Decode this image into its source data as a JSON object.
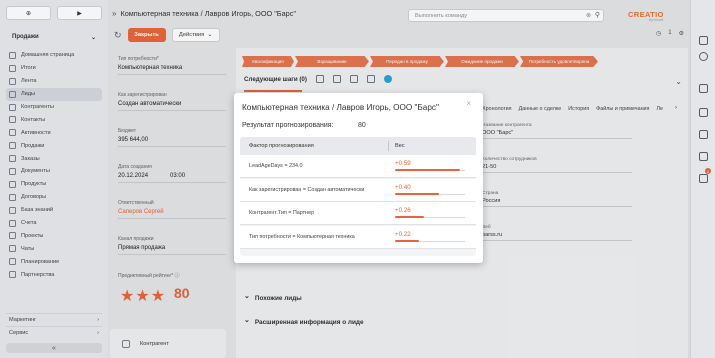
{
  "topbar": {
    "breadcrumb": "Компьютерная техника / Лавров Игорь, ООО \"Барс\"",
    "command_placeholder": "Выполнить команду",
    "brand": "CREATIO"
  },
  "toolbar": {
    "close_label": "Закрыть",
    "actions_label": "Действия",
    "counter": "1"
  },
  "sidebar": {
    "workplace": "Продажи",
    "items": [
      {
        "label": "Домашняя страница",
        "icon": "home-icon"
      },
      {
        "label": "Итоги",
        "icon": "chart-icon"
      },
      {
        "label": "Лента",
        "icon": "feed-icon"
      },
      {
        "label": "Лиды",
        "icon": "lead-icon",
        "active": true
      },
      {
        "label": "Контрагенты",
        "icon": "company-icon"
      },
      {
        "label": "Контакты",
        "icon": "contact-icon"
      },
      {
        "label": "Активности",
        "icon": "activity-icon"
      },
      {
        "label": "Продажи",
        "icon": "sales-icon"
      },
      {
        "label": "Заказы",
        "icon": "order-icon"
      },
      {
        "label": "Документы",
        "icon": "document-icon"
      },
      {
        "label": "Продукты",
        "icon": "product-icon"
      },
      {
        "label": "Договоры",
        "icon": "contract-icon"
      },
      {
        "label": "База знаний",
        "icon": "knowledge-icon"
      },
      {
        "label": "Счета",
        "icon": "invoice-icon"
      },
      {
        "label": "Проекты",
        "icon": "project-icon"
      },
      {
        "label": "Чаты",
        "icon": "chat-icon"
      },
      {
        "label": "Планирование",
        "icon": "planning-icon"
      },
      {
        "label": "Партнерства",
        "icon": "partner-icon"
      }
    ],
    "groups": [
      "Маркетинг",
      "Сервис"
    ]
  },
  "leftfields": [
    {
      "label": "Тип потребности*",
      "value": "Компьютерная техника"
    },
    {
      "label": "Как зарегистрирован",
      "value": "Создан автоматически"
    },
    {
      "label": "Бюджет",
      "value": "395 644,00"
    },
    {
      "label": "Дата создания",
      "value": "20.12.2024",
      "value2": "03:00"
    },
    {
      "label": "Ответственный",
      "value": "Саперов Сергей",
      "link": true
    },
    {
      "label": "Канал продажи",
      "value": "Прямая продажа"
    }
  ],
  "rating": {
    "label": "Предиктивный рейтинг*",
    "stars": 3,
    "value": "80"
  },
  "kontragent_box": "Контрагент",
  "stages": [
    {
      "label": "Квалификация",
      "w": 52
    },
    {
      "label": "Взращивание",
      "w": 74
    },
    {
      "label": "Передан в продажу",
      "w": 74
    },
    {
      "label": "Ожидание продажи",
      "w": 74
    },
    {
      "label": "Потребность удовлетворена",
      "w": 78
    }
  ],
  "next_steps": "Следующие шаги (0)",
  "right_tabs": [
    "Хронология",
    "Данные о сделке",
    "История",
    "Файлы и примечания",
    "Ле"
  ],
  "right_fields": [
    {
      "label": "Название контрагента",
      "value": "ООО \"Барс\""
    },
    {
      "label": "Количество сотрудников",
      "value": "21-50"
    },
    {
      "label": "Страна",
      "value": "Россия"
    },
    {
      "label": "Веб",
      "value": "barss.ru"
    }
  ],
  "sections": [
    "Похожие лиды",
    "Расширенная информация о лиде"
  ],
  "modal": {
    "title": "Компьютерная техника / Лавров Игорь, ООО \"Барс\"",
    "result_label": "Результат прогнозирования:",
    "result_value": "80",
    "col_factor": "Фактор прогнозирования",
    "col_weight": "Вес",
    "rows": [
      {
        "factor": "LeadAgeDays = 234.0",
        "weight": "+0.59",
        "frac": 0.59
      },
      {
        "factor": "Как зарегистрирован = Создан автоматически",
        "weight": "+0.40",
        "frac": 0.4
      },
      {
        "factor": "Контрагент.Тип = Партнер",
        "weight": "+0.26",
        "frac": 0.26
      },
      {
        "factor": "Тип потребности = Компьютерная техника",
        "weight": "+0.22",
        "frac": 0.22
      }
    ]
  },
  "colors": {
    "accent": "#e8653a",
    "brand": "#e87434"
  }
}
